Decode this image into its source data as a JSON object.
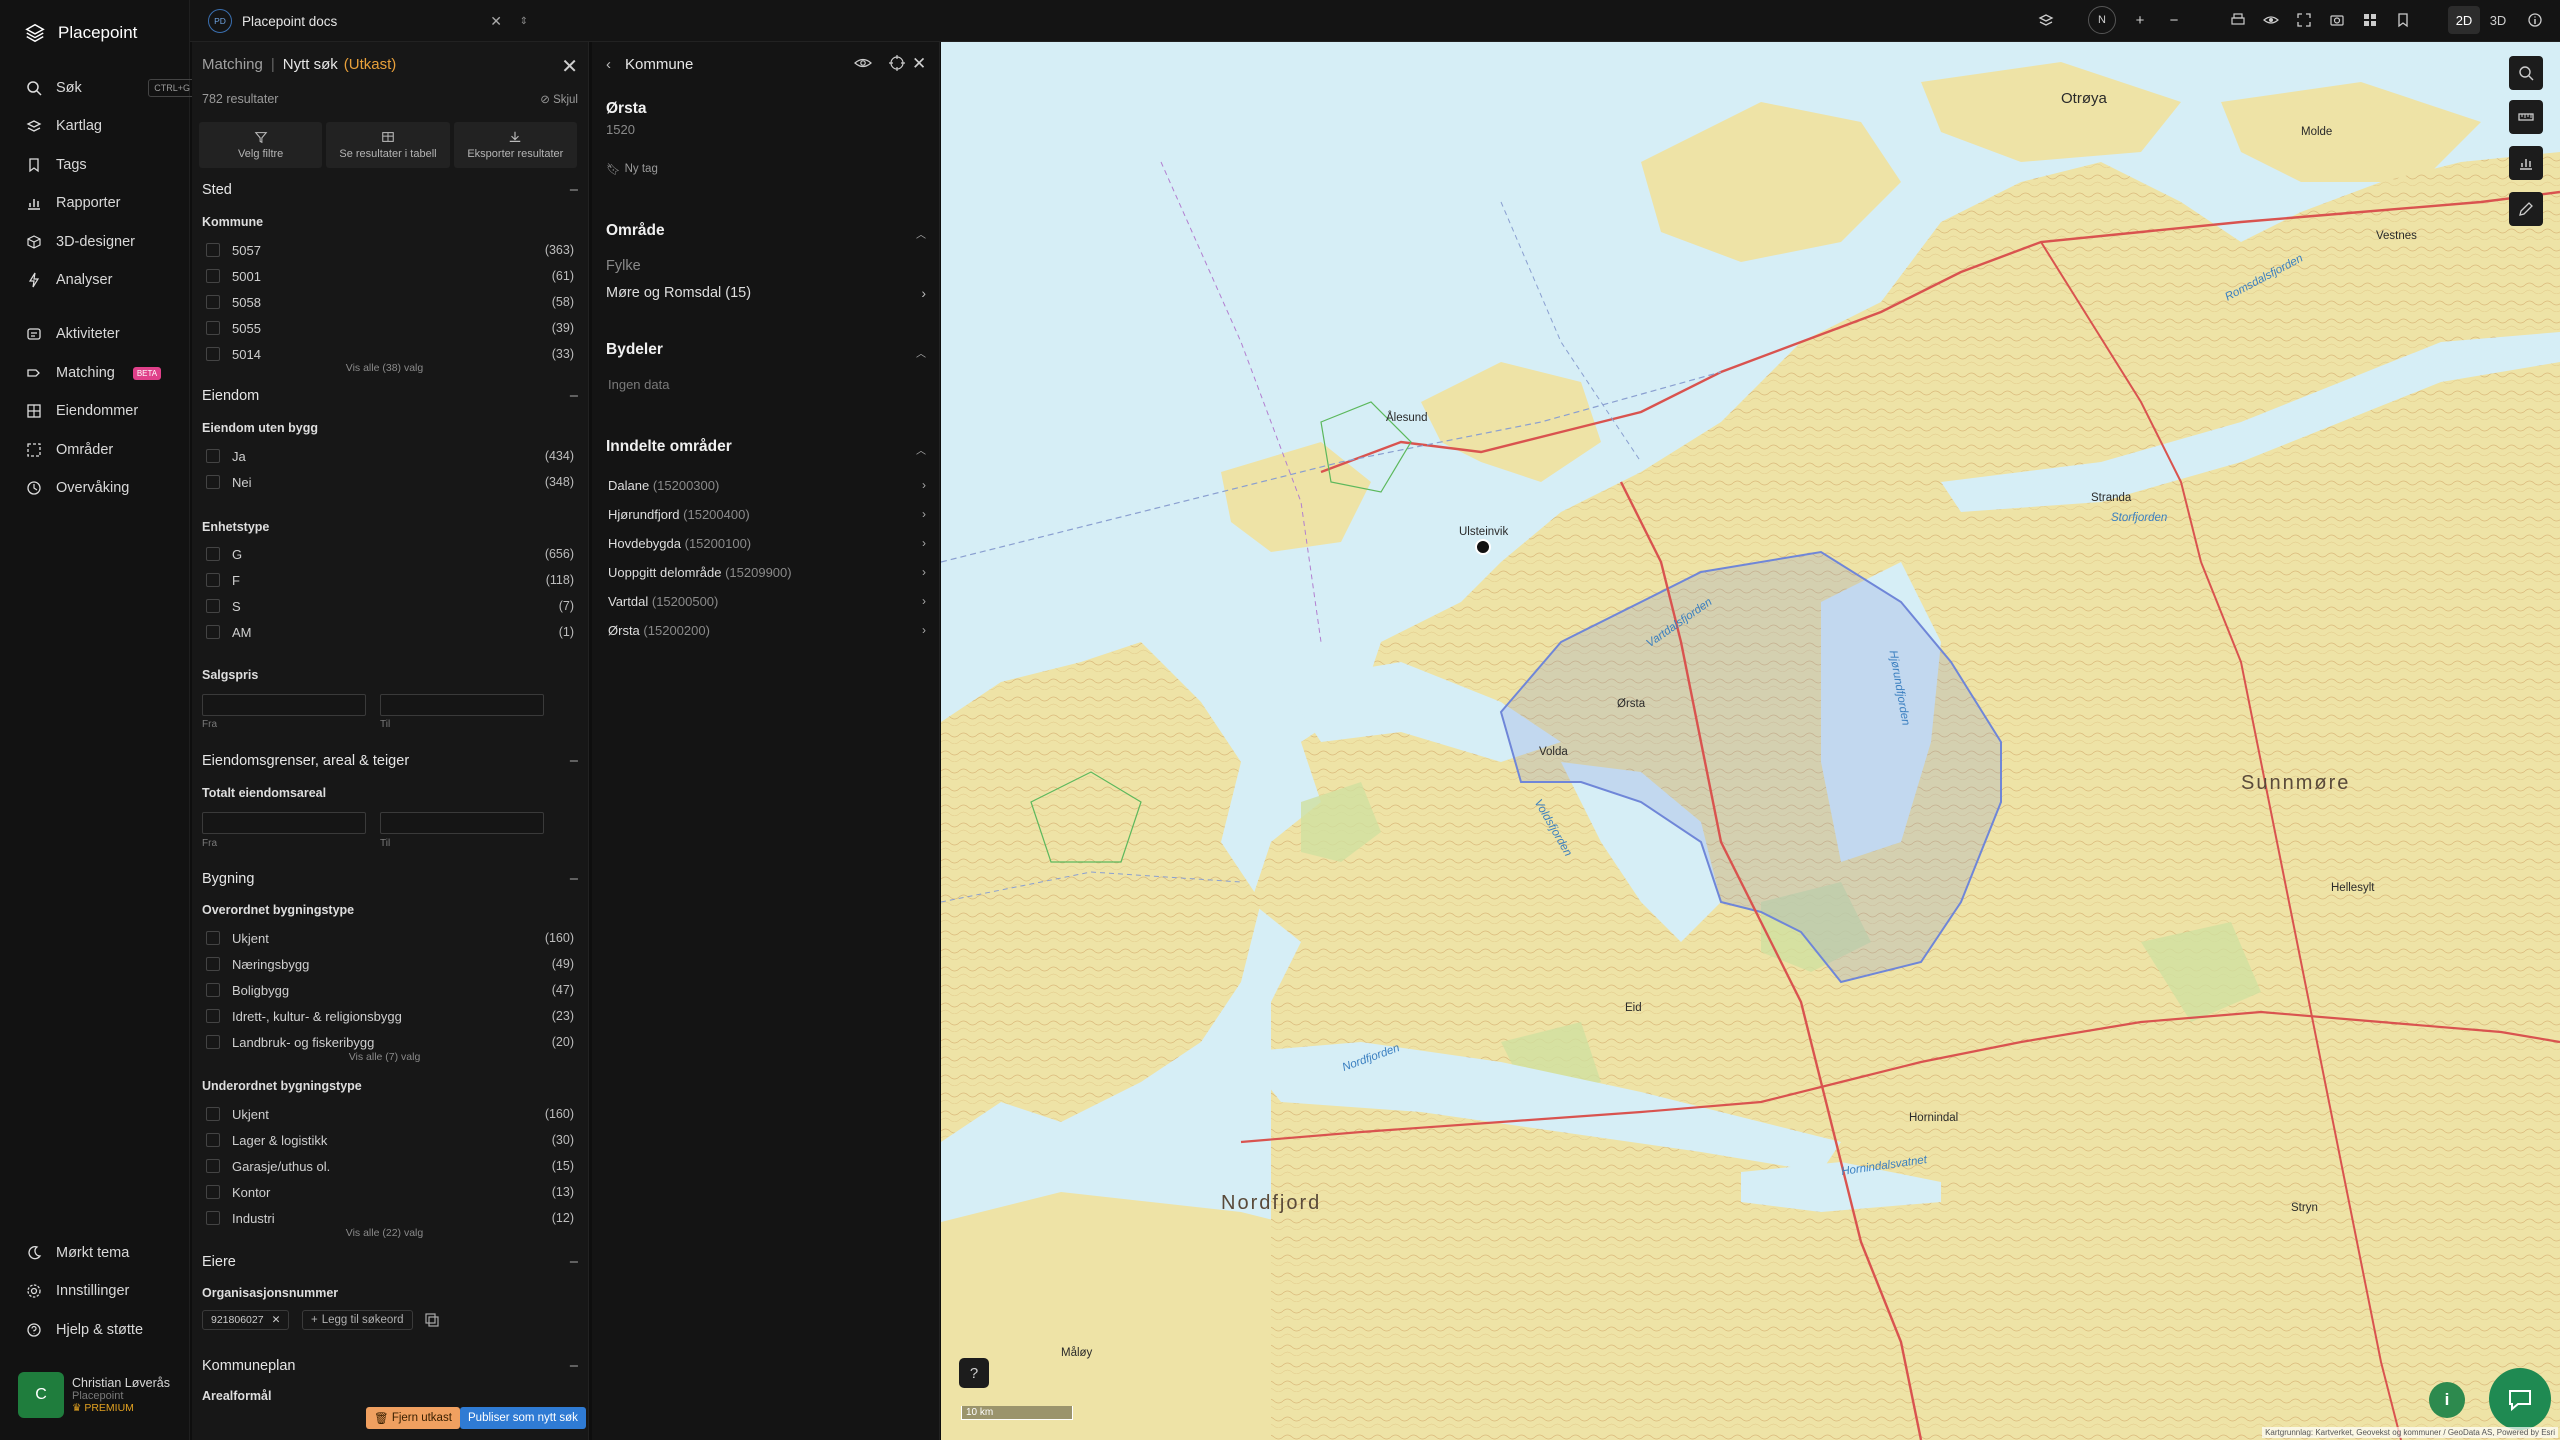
{
  "nav": {
    "logo": "Placepoint",
    "items": [
      {
        "label": "Søk",
        "icon": "search-icon",
        "shortcut": "CTRL+G"
      },
      {
        "label": "Kartlag",
        "icon": "layers-icon"
      },
      {
        "label": "Tags",
        "icon": "bookmark-icon"
      },
      {
        "label": "Rapporter",
        "icon": "chart-icon"
      },
      {
        "label": "3D-designer",
        "icon": "cube-icon"
      },
      {
        "label": "Analyser",
        "icon": "bolt-icon"
      },
      {
        "label": "Aktiviteter",
        "icon": "activity-icon"
      },
      {
        "label": "Matching",
        "icon": "target-icon",
        "badge": "BETA"
      },
      {
        "label": "Eiendommer",
        "icon": "grid-icon"
      },
      {
        "label": "Områder",
        "icon": "area-icon"
      },
      {
        "label": "Overvåking",
        "icon": "monitor-icon"
      }
    ],
    "bottom": [
      {
        "label": "Mørkt tema",
        "icon": "moon-icon"
      },
      {
        "label": "Innstillinger",
        "icon": "gear-icon"
      },
      {
        "label": "Hjelp & støtte",
        "icon": "help-icon"
      }
    ],
    "user": {
      "initial": "C",
      "name": "Christian Løverås",
      "org": "Placepoint",
      "plan": "PREMIUM"
    }
  },
  "topbar": {
    "doc_badge": "PD",
    "doc_name": "Placepoint docs",
    "compass": "N",
    "mode_2d": "2D",
    "mode_3d": "3D"
  },
  "filters": {
    "crumb": "Matching",
    "title": "Nytt søk",
    "draft": "(Utkast)",
    "results": "782 resultater",
    "hide": "Skjul",
    "actions": [
      "Velg filtre",
      "Se resultater i tabell",
      "Eksporter resultater"
    ],
    "sted": {
      "title": "Sted",
      "kommune_label": "Kommune",
      "kommune": [
        {
          "label": "5057",
          "count": "(363)"
        },
        {
          "label": "5001",
          "count": "(61)"
        },
        {
          "label": "5058",
          "count": "(58)"
        },
        {
          "label": "5055",
          "count": "(39)"
        },
        {
          "label": "5014",
          "count": "(33)"
        }
      ],
      "more": "Vis alle (38) valg"
    },
    "eiendom": {
      "title": "Eiendom",
      "uten_bygg_label": "Eiendom uten bygg",
      "uten_bygg": [
        {
          "label": "Ja",
          "count": "(434)"
        },
        {
          "label": "Nei",
          "count": "(348)"
        }
      ],
      "enhetstype_label": "Enhetstype",
      "enhetstype": [
        {
          "label": "G",
          "count": "(656)"
        },
        {
          "label": "F",
          "count": "(118)"
        },
        {
          "label": "S",
          "count": "(7)"
        },
        {
          "label": "AM",
          "count": "(1)"
        }
      ],
      "salgspris_label": "Salgspris",
      "from": "Fra",
      "to": "Til"
    },
    "grenser": {
      "title": "Eiendomsgrenser, areal & teiger",
      "areal_label": "Totalt eiendomsareal",
      "from": "Fra",
      "to": "Til"
    },
    "bygning": {
      "title": "Bygning",
      "overordnet_label": "Overordnet bygningstype",
      "overordnet": [
        {
          "label": "Ukjent",
          "count": "(160)"
        },
        {
          "label": "Næringsbygg",
          "count": "(49)"
        },
        {
          "label": "Boligbygg",
          "count": "(47)"
        },
        {
          "label": "Idrett-, kultur- & religionsbygg",
          "count": "(23)"
        },
        {
          "label": "Landbruk- og fiskeribygg",
          "count": "(20)"
        }
      ],
      "overordnet_more": "Vis alle (7) valg",
      "underordnet_label": "Underordnet bygningstype",
      "underordnet": [
        {
          "label": "Ukjent",
          "count": "(160)"
        },
        {
          "label": "Lager & logistikk",
          "count": "(30)"
        },
        {
          "label": "Garasje/uthus ol.",
          "count": "(15)"
        },
        {
          "label": "Kontor",
          "count": "(13)"
        },
        {
          "label": "Industri",
          "count": "(12)"
        }
      ],
      "underordnet_more": "Vis alle (22) valg"
    },
    "eiere": {
      "title": "Eiere",
      "org_label": "Organisasjonsnummer",
      "chip": "921806027",
      "add": "Legg til søkeord"
    },
    "kommuneplan": {
      "title": "Kommuneplan",
      "sub": "Arealformål"
    },
    "btn_remove": "Fjern utkast",
    "btn_publish": "Publiser som nytt søk"
  },
  "detail": {
    "header": "Kommune",
    "name": "Ørsta",
    "code": "1520",
    "tag": "Ny tag",
    "omrade_title": "Område",
    "fylke_label": "Fylke",
    "fylke_value": "Møre og Romsdal (15)",
    "bydeler_title": "Bydeler",
    "bydeler_empty": "Ingen data",
    "inndelte_title": "Inndelte områder",
    "inndelte": [
      {
        "name": "Dalane",
        "code": "(15200300)"
      },
      {
        "name": "Hjørundfjord",
        "code": "(15200400)"
      },
      {
        "name": "Hovdebygda",
        "code": "(15200100)"
      },
      {
        "name": "Uoppgitt delområde",
        "code": "(15209900)"
      },
      {
        "name": "Vartdal",
        "code": "(15200500)"
      },
      {
        "name": "Ørsta",
        "code": "(15200200)"
      }
    ]
  },
  "map": {
    "scale": "10 km",
    "attribution": "Kartgrunnlag: Kartverket, Geovekst og kommuner / GeoData AS, Powered by Esri",
    "places": [
      {
        "name": "Ålesund",
        "kind": "town"
      },
      {
        "name": "Sunnmøre",
        "kind": "region"
      },
      {
        "name": "Nordfjord",
        "kind": "region"
      },
      {
        "name": "Otrøya",
        "kind": "town"
      },
      {
        "name": "Molde",
        "kind": "town"
      },
      {
        "name": "Vestnes",
        "kind": "town"
      },
      {
        "name": "Ulsteinvik",
        "kind": "town"
      },
      {
        "name": "Volda",
        "kind": "town"
      },
      {
        "name": "Ørsta",
        "kind": "town"
      },
      {
        "name": "Stranda",
        "kind": "town"
      },
      {
        "name": "Hellesylt",
        "kind": "town"
      },
      {
        "name": "Stryn",
        "kind": "town"
      },
      {
        "name": "Hornindal",
        "kind": "town"
      },
      {
        "name": "Eid",
        "kind": "town"
      },
      {
        "name": "Måløy",
        "kind": "town"
      },
      {
        "name": "Storfjorden",
        "kind": "sea"
      },
      {
        "name": "Vartdalsfjorden",
        "kind": "sea"
      },
      {
        "name": "Voldsfjorden",
        "kind": "sea"
      },
      {
        "name": "Nordfjorden",
        "kind": "sea"
      },
      {
        "name": "Hornindalsvatnet",
        "kind": "sea"
      },
      {
        "name": "Hjørundfjorden",
        "kind": "sea"
      },
      {
        "name": "Romsdalsfjorden",
        "kind": "sea"
      }
    ]
  },
  "colors": {
    "accent": "#2f7bd4",
    "draft": "#e8a03a",
    "land": "#eee3a6",
    "water": "#d6eef6",
    "forest": "#cfe0a0",
    "road": "#d9534f",
    "highlight": "#7b8fd6"
  }
}
